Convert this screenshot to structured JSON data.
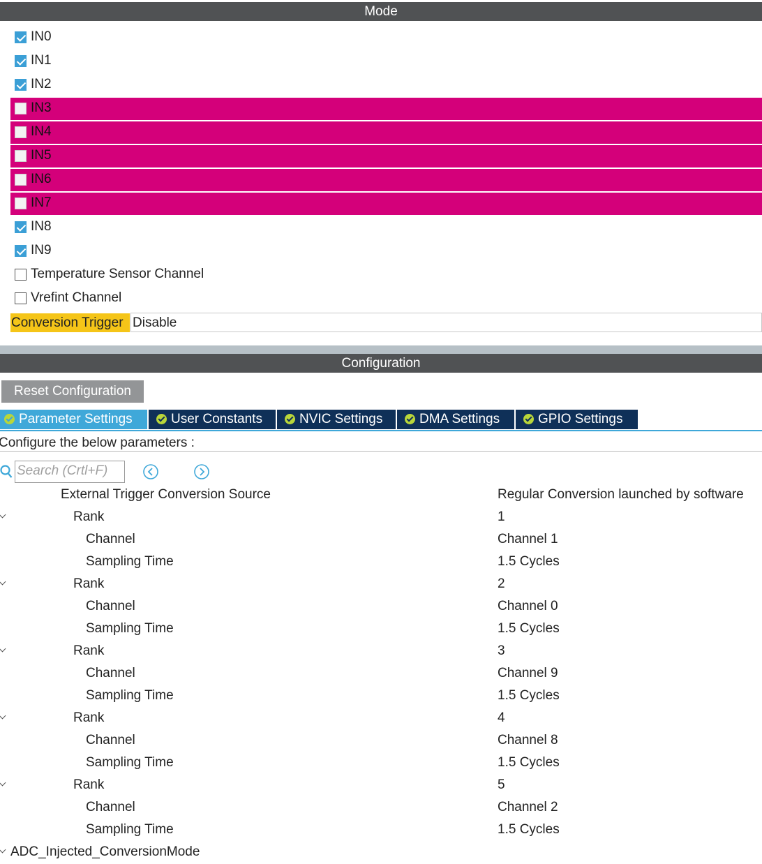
{
  "mode": {
    "title": "Mode",
    "channels": [
      {
        "label": "IN0",
        "checked": true,
        "conflict": false
      },
      {
        "label": "IN1",
        "checked": true,
        "conflict": false
      },
      {
        "label": "IN2",
        "checked": true,
        "conflict": false
      },
      {
        "label": "IN3",
        "checked": false,
        "conflict": true
      },
      {
        "label": "IN4",
        "checked": false,
        "conflict": true
      },
      {
        "label": "IN5",
        "checked": false,
        "conflict": true
      },
      {
        "label": "IN6",
        "checked": false,
        "conflict": true
      },
      {
        "label": "IN7",
        "checked": false,
        "conflict": true
      },
      {
        "label": "IN8",
        "checked": true,
        "conflict": false
      },
      {
        "label": "IN9",
        "checked": true,
        "conflict": false
      },
      {
        "label": "Temperature Sensor Channel",
        "checked": false,
        "conflict": false
      },
      {
        "label": "Vrefint Channel",
        "checked": false,
        "conflict": false
      }
    ],
    "conversion_trigger": {
      "label": "Conversion Trigger",
      "value": "Disable"
    }
  },
  "configuration": {
    "title": "Configuration",
    "reset_label": "Reset Configuration",
    "tabs": [
      {
        "label": "Parameter Settings",
        "active": true
      },
      {
        "label": "User Constants",
        "active": false
      },
      {
        "label": "NVIC Settings",
        "active": false
      },
      {
        "label": "DMA Settings",
        "active": false
      },
      {
        "label": "GPIO Settings",
        "active": false
      }
    ],
    "instructions": "Configure the below parameters :",
    "search_placeholder": "Search (Crtl+F)",
    "params": [
      {
        "name": "External Trigger Conversion Source",
        "value": "Regular Conversion launched by software",
        "level": 1,
        "chevron": false
      },
      {
        "name": "Rank",
        "value": "1",
        "level": 2,
        "chevron": true
      },
      {
        "name": "Channel",
        "value": "Channel 1",
        "level": 3,
        "chevron": false
      },
      {
        "name": "Sampling Time",
        "value": "1.5 Cycles",
        "level": 3,
        "chevron": false
      },
      {
        "name": "Rank",
        "value": "2",
        "level": 2,
        "chevron": true
      },
      {
        "name": "Channel",
        "value": "Channel 0",
        "level": 3,
        "chevron": false
      },
      {
        "name": "Sampling Time",
        "value": "1.5 Cycles",
        "level": 3,
        "chevron": false
      },
      {
        "name": "Rank",
        "value": "3",
        "level": 2,
        "chevron": true
      },
      {
        "name": "Channel",
        "value": "Channel 9",
        "level": 3,
        "chevron": false
      },
      {
        "name": "Sampling Time",
        "value": "1.5 Cycles",
        "level": 3,
        "chevron": false
      },
      {
        "name": "Rank",
        "value": "4",
        "level": 2,
        "chevron": true
      },
      {
        "name": "Channel",
        "value": "Channel 8",
        "level": 3,
        "chevron": false
      },
      {
        "name": "Sampling Time",
        "value": "1.5 Cycles",
        "level": 3,
        "chevron": false
      },
      {
        "name": "Rank",
        "value": "5",
        "level": 2,
        "chevron": true
      },
      {
        "name": "Channel",
        "value": "Channel 2",
        "level": 3,
        "chevron": false
      },
      {
        "name": "Sampling Time",
        "value": "1.5 Cycles",
        "level": 3,
        "chevron": false
      },
      {
        "name": "ADC_Injected_ConversionMode",
        "value": "",
        "level": 0,
        "chevron": true
      }
    ]
  }
}
